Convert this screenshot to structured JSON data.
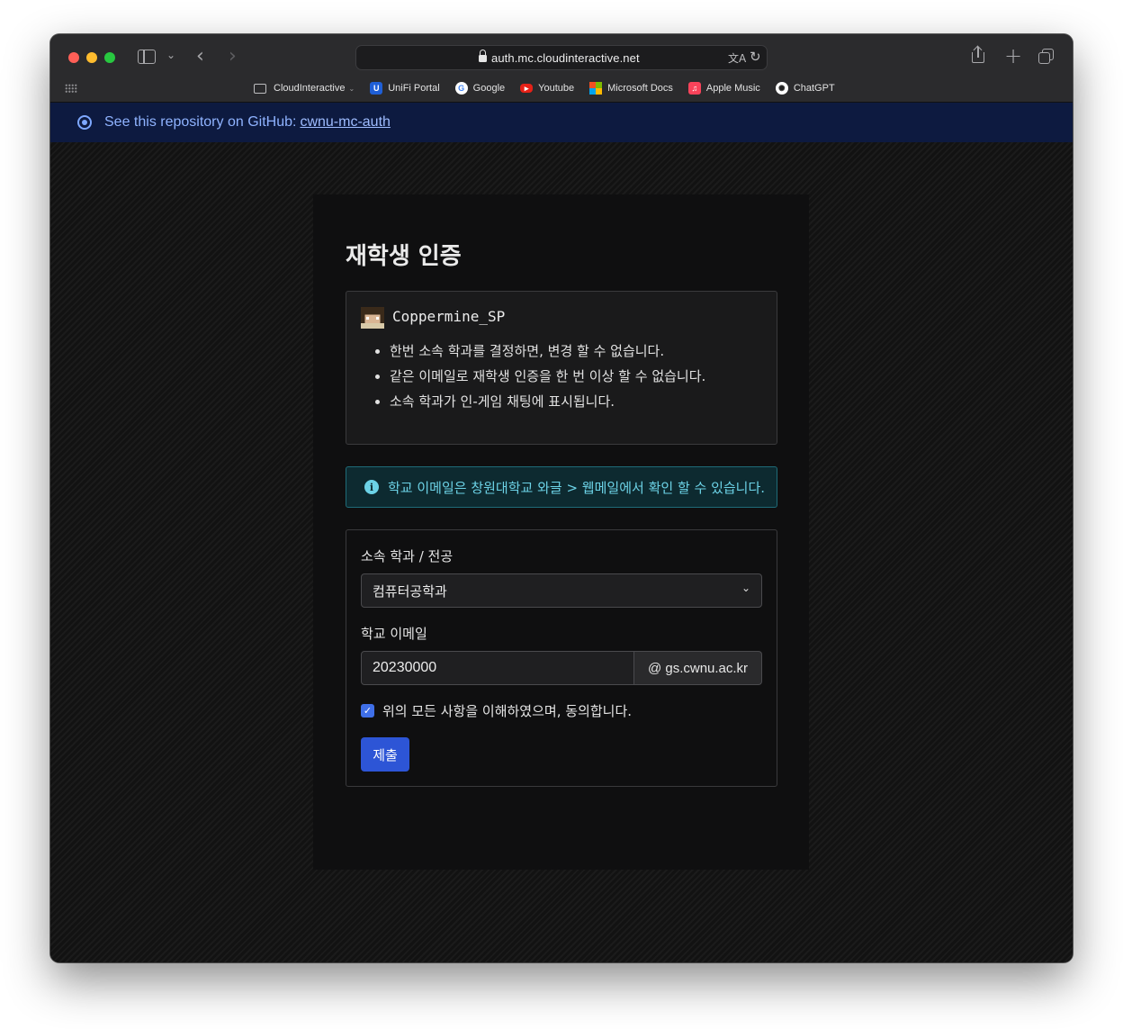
{
  "browser": {
    "url": "auth.mc.cloudinteractive.net",
    "bookmarks": [
      {
        "label": "CloudInteractive",
        "icon": "folder-icon"
      },
      {
        "label": "UniFi Portal",
        "icon": "unifi-icon"
      },
      {
        "label": "Google",
        "icon": "google-icon"
      },
      {
        "label": "Youtube",
        "icon": "youtube-icon"
      },
      {
        "label": "Microsoft Docs",
        "icon": "microsoft-icon"
      },
      {
        "label": "Apple Music",
        "icon": "apple-music-icon"
      },
      {
        "label": "ChatGPT",
        "icon": "chatgpt-icon"
      }
    ]
  },
  "banner": {
    "text": "See this repository on GitHub:",
    "link": "cwnu-mc-auth"
  },
  "page": {
    "title": "재학생 인증",
    "notice": {
      "username": "Coppermine_SP",
      "rules": [
        "한번 소속 학과를 결정하면, 변경 할 수 없습니다.",
        "같은 이메일로 재학생 인증을 한 번 이상 할 수 없습니다.",
        "소속 학과가 인-게임 채팅에 표시됩니다."
      ]
    },
    "info": "학교 이메일은 창원대학교 와글 > 웹메일에서 확인 할 수 있습니다.",
    "form": {
      "dept_label": "소속 학과 / 전공",
      "dept_value": "컴퓨터공학과",
      "email_label": "학교 이메일",
      "email_value": "20230000",
      "email_suffix": "@ gs.cwnu.ac.kr",
      "agree_label": "위의 모든 사항을 이해하였으며, 동의합니다.",
      "agree_checked": true,
      "submit_label": "제출"
    }
  },
  "colors": {
    "accent": "#2d55d6",
    "info": "#6cd2e6",
    "banner_bg": "#0d1a40"
  }
}
